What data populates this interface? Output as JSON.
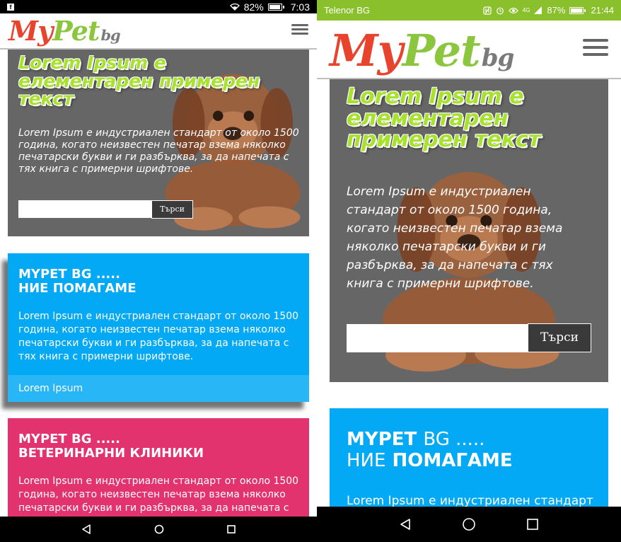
{
  "left": {
    "status": {
      "battery": "82%",
      "time": "7:03",
      "battery_level": 0.82
    },
    "logo": {
      "my": "My",
      "pet": "Pet",
      "bg": "bg"
    },
    "hero": {
      "title": "Lorem Ipsum е елементарен примерен текст",
      "text": "Lorem Ipsum е индустриален стандарт от около 1500 година, когато неизвестен печатар взема няколко печатарски букви и ги разбърква, за да напечата с тях книга с примерни шрифтове.",
      "search_placeholder": "",
      "search_button": "Търси"
    },
    "card1": {
      "title_line1": "MYPET BG .....",
      "title_line2": "НИЕ ПОМАГАМЕ",
      "text": "Lorem Ipsum е индустриален стандарт от около 1500 година, когато неизвестен печатар взема няколко печатарски букви и ги разбърква, за да напечата с тях книга с примерни шрифтове.",
      "footer": "Lorem Ipsum"
    },
    "card2": {
      "title_line1": "MYPET BG .....",
      "title_line2": "ВЕТЕРИНАРНИ КЛИНИКИ",
      "text": "Lorem Ipsum е индустриален стандарт от около 1500 година, когато неизвестен печатар взема няколко печатарски букви и ги разбърква, за да напечата с тях книга с примерни шрифтове."
    }
  },
  "right": {
    "status": {
      "carrier": "Telenor BG",
      "battery": "87%",
      "time": "21:44",
      "network": "4G",
      "battery_level": 0.87
    },
    "logo": {
      "my": "My",
      "pet": "Pet",
      "bg": "bg"
    },
    "hero": {
      "title": "Lorem Ipsum е елементарен примерен текст",
      "text": "Lorem Ipsum е индустриален стандарт от около 1500 година, когато неизвестен печатар взема няколко печатарски букви и ги разбърква, за да напечата с тях книга с примерни шрифтове.",
      "search_placeholder": "",
      "search_button": "Търси"
    },
    "card1": {
      "title_line1_bold": "MYPET",
      "title_line1_light": "BG .....",
      "title_line2_light": "НИЕ",
      "title_line2_bold": "ПОМАГАМЕ",
      "text": "Lorem Ipsum е индустриален стандарт"
    }
  },
  "colors": {
    "status_left": "#000000",
    "status_right": "#89c02b",
    "hero_bg": "#666666",
    "hero_title": "#a6e22e",
    "card_blue": "#03a9f4",
    "card_blue_footer": "#29b6f6",
    "card_pink": "#e2336f",
    "logo_my": "#e8432d",
    "logo_pet": "#8cc63f"
  },
  "icons": [
    "facebook-icon",
    "wifi-icon",
    "battery-icon",
    "nfc-icon",
    "alarm-icon",
    "eye-icon",
    "signal-icon",
    "menu-icon",
    "back-icon",
    "home-icon",
    "recents-icon"
  ]
}
